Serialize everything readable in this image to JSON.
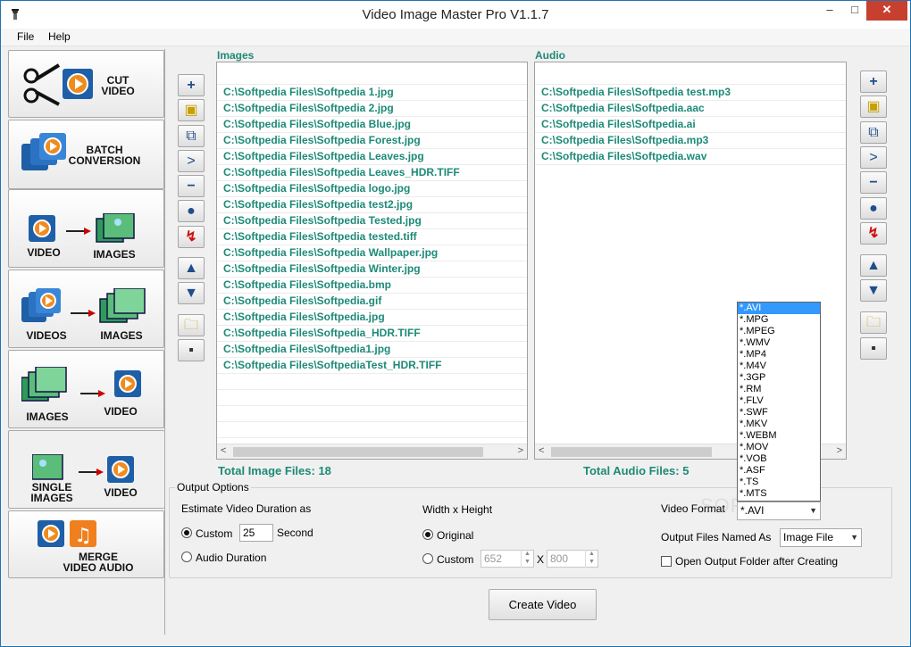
{
  "window": {
    "title": "Video Image Master Pro V1.1.7",
    "minimize": "–",
    "maximize": "□",
    "close": "✕"
  },
  "menu": [
    "File",
    "Help"
  ],
  "sidebar": [
    {
      "label": "CUT\nVIDEO",
      "icon": "scissors-video-icon"
    },
    {
      "label": "BATCH\nCONVERSION",
      "icon": "batch-conversion-icon"
    },
    {
      "label1": "VIDEO",
      "label2": "IMAGES",
      "icon": "video-to-images-icon"
    },
    {
      "label1": "VIDEOS",
      "label2": "IMAGES",
      "icon": "videos-to-images-icon"
    },
    {
      "label1": "IMAGES",
      "label2": "VIDEO",
      "icon": "images-to-video-icon"
    },
    {
      "label1": "SINGLE\nIMAGES",
      "label2": "VIDEO",
      "icon": "single-image-to-video-icon"
    },
    {
      "label": "MERGE\nVIDEO AUDIO",
      "icon": "merge-video-audio-icon"
    }
  ],
  "images": {
    "heading": "Images",
    "files": [
      "C:\\Softpedia Files\\Softpedia 1.jpg",
      "C:\\Softpedia Files\\Softpedia 2.jpg",
      "C:\\Softpedia Files\\Softpedia Blue.jpg",
      "C:\\Softpedia Files\\Softpedia Forest.jpg",
      "C:\\Softpedia Files\\Softpedia Leaves.jpg",
      "C:\\Softpedia Files\\Softpedia Leaves_HDR.TIFF",
      "C:\\Softpedia Files\\Softpedia logo.jpg",
      "C:\\Softpedia Files\\Softpedia test2.jpg",
      "C:\\Softpedia Files\\Softpedia Tested.jpg",
      "C:\\Softpedia Files\\Softpedia tested.tiff",
      "C:\\Softpedia Files\\Softpedia Wallpaper.jpg",
      "C:\\Softpedia Files\\Softpedia Winter.jpg",
      "C:\\Softpedia Files\\Softpedia.bmp",
      "C:\\Softpedia Files\\Softpedia.gif",
      "C:\\Softpedia Files\\Softpedia.jpg",
      "C:\\Softpedia Files\\Softpedia_HDR.TIFF",
      "C:\\Softpedia Files\\Softpedia1.jpg",
      "C:\\Softpedia Files\\SoftpediaTest_HDR.TIFF"
    ],
    "total": "Total Image Files: 18"
  },
  "audio": {
    "heading": "Audio",
    "files": [
      "C:\\Softpedia Files\\Softpedia test.mp3",
      "C:\\Softpedia Files\\Softpedia.aac",
      "C:\\Softpedia Files\\Softpedia.ai",
      "C:\\Softpedia Files\\Softpedia.mp3",
      "C:\\Softpedia Files\\Softpedia.wav"
    ],
    "total": "Total Audio Files: 5"
  },
  "toolbar_icons": [
    "add-icon",
    "add-folder-icon",
    "duplicate-icon",
    "move-right-icon",
    "remove-icon",
    "dot-icon",
    "clear-all-icon",
    "move-up-icon",
    "move-down-icon",
    "open-folder-icon",
    "save-icon"
  ],
  "output": {
    "group_title": "Output Options",
    "duration_label": "Estimate Video Duration as",
    "custom_label": "Custom",
    "custom_value": "25",
    "second_label": "Second",
    "audio_duration_label": "Audio Duration",
    "wh_label": "Width x Height",
    "original_label": "Original",
    "custom_wh_label": "Custom",
    "width_value": "652",
    "x_label": "X",
    "height_value": "800",
    "format_label": "Video Format",
    "format_value": "*.AVI",
    "named_label": "Output Files Named As",
    "named_value": "Image File",
    "open_folder_label": "Open Output Folder after Creating",
    "open_folder_checked": false
  },
  "format_options": [
    "*.AVI",
    "*.MPG",
    "*.MPEG",
    "*.WMV",
    "*.MP4",
    "*.M4V",
    "*.3GP",
    "*.RM",
    "*.FLV",
    "*.SWF",
    "*.MKV",
    "*.WEBM",
    "*.MOV",
    "*.VOB",
    "*.ASF",
    "*.TS",
    "*.MTS"
  ],
  "create_button": "Create Video",
  "watermark": "SOFTPEDIA"
}
